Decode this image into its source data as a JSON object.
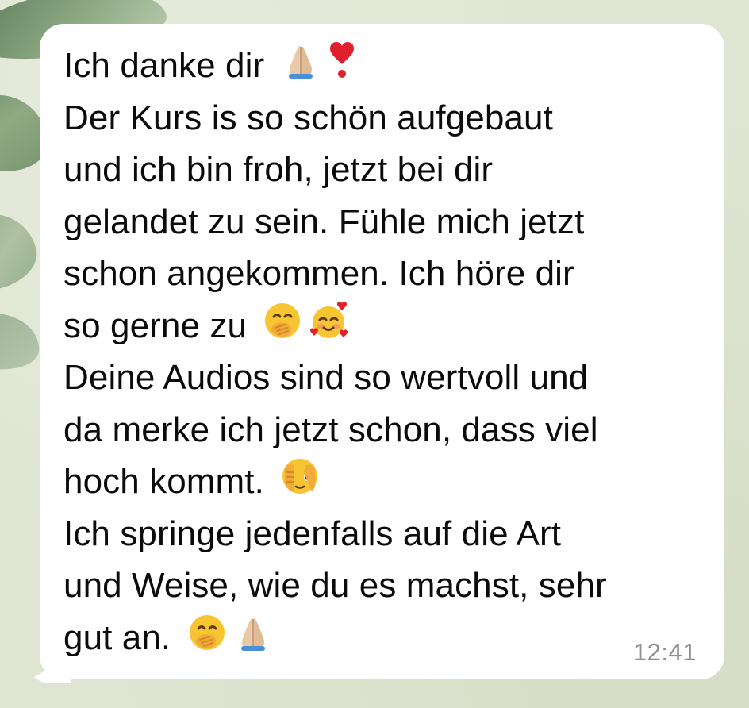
{
  "chat": {
    "message": {
      "lines": [
        "Ich danke dir",
        "Der Kurs is so schön aufgebaut",
        "und ich bin froh, jetzt bei dir",
        "gelandet zu sein. Fühle mich jetzt",
        "schon angekommen. Ich höre dir",
        "so gerne zu",
        "Deine Audios sind so wertvoll und",
        "da merke ich jetzt schon, dass viel",
        "hoch kommt.",
        "Ich springe jedenfalls auf die Art",
        "und Weise, wie du es machst, sehr",
        "gut an."
      ],
      "emojis": {
        "line0": [
          "folded-hands-icon",
          "heart-exclamation-icon"
        ],
        "line5": [
          "face-with-hand-over-mouth-icon",
          "smiling-face-with-hearts-icon"
        ],
        "line8": [
          "face-with-peeking-eye-icon"
        ],
        "line11": [
          "face-with-hand-over-mouth-icon",
          "folded-hands-icon"
        ]
      },
      "timestamp": "12:41"
    }
  },
  "colors": {
    "bubble": "#ffffff",
    "text": "#0b0b0b",
    "timestamp": "#8e8e93",
    "wallpaper": "#dfe5d2",
    "leaf": "#6d8c63"
  }
}
